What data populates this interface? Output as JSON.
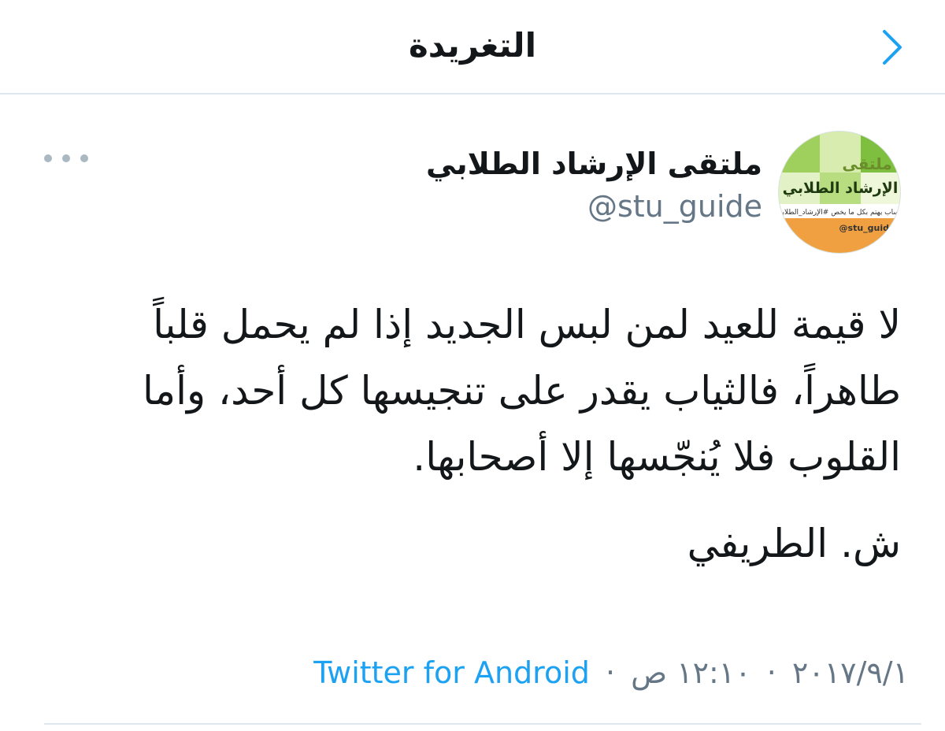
{
  "header": {
    "title": "التغريدة",
    "back_icon": "chevron-right-icon",
    "accent_color": "#1da1f2"
  },
  "tweet": {
    "author": {
      "display_name": "ملتقى الإرشاد الطلابي",
      "username": "@stu_guide",
      "avatar": {
        "title_line1": "ملتقى",
        "title_line2": "الإرشاد الطلابي",
        "strip_text": "حساب يهتم بكل ما يخص #الإرشاد_الطلابي",
        "handle_text": "@stu_guide"
      }
    },
    "more_icon": "more-horizontal-icon",
    "text": "لا قيمة للعيد لمن لبس الجديد إذا لم يحمل قلباً طاهراً، فالثياب يقدر على تنجيسها كل أحد، وأما القلوب فلا يُنجّسها إلا أصحابها.",
    "signature": "ش. الطريفي",
    "date": "٢٠١٧/٩/١",
    "separator": "·",
    "time": "١٢:١٠ ص",
    "source": "Twitter for Android"
  },
  "colors": {
    "text_primary": "#14171a",
    "text_secondary": "#657786",
    "link": "#1da1f2",
    "divider": "#e1e8ed"
  }
}
